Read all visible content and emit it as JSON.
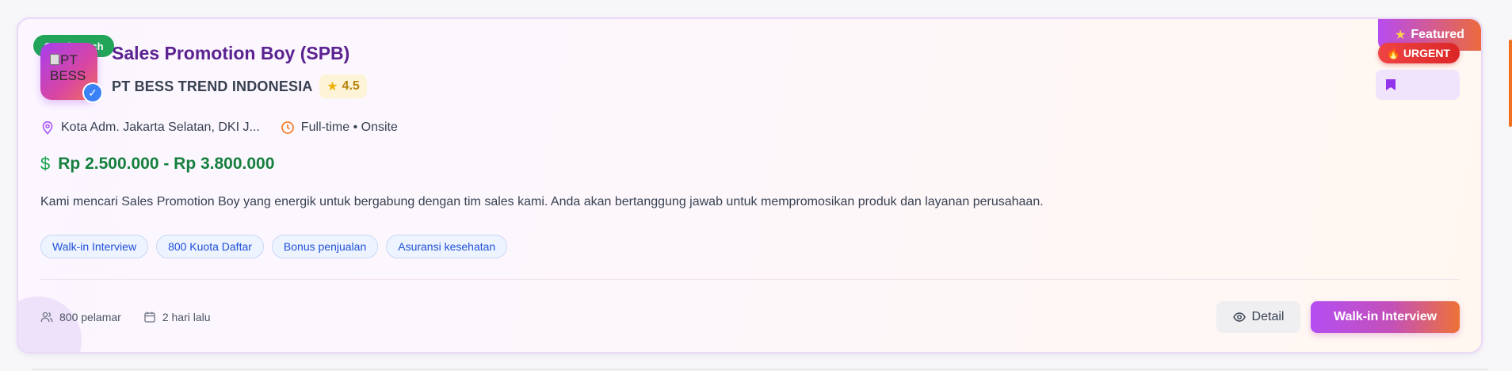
{
  "card": {
    "featured_label": "Featured",
    "urgent_label": "URGENT",
    "match_label": "Good Match",
    "logo_alt": "PT BESS",
    "verified_glyph": "✓",
    "title": "Sales Promotion Boy (SPB)",
    "company": "PT BESS TREND INDONESIA",
    "rating": "4.5",
    "location": "Kota Adm. Jakarta Selatan, DKI J...",
    "employment": "Full-time • Onsite",
    "salary": "Rp 2.500.000 - Rp 3.800.000",
    "description": "Kami mencari Sales Promotion Boy yang energik untuk bergabung dengan tim sales kami. Anda akan bertanggung jawab untuk mempromosikan produk dan layanan perusahaan.",
    "tags": [
      "Walk-in Interview",
      "800 Kuota Daftar",
      "Bonus penjualan",
      "Asuransi kesehatan"
    ],
    "applicants": "800 pelamar",
    "posted": "2 hari lalu",
    "detail_label": "Detail",
    "apply_label": "Walk-in Interview"
  },
  "icons": {
    "featured": "star-icon",
    "urgent": "fire-icon",
    "bookmark": "bookmark-icon",
    "rating": "star-icon",
    "location": "map-pin-icon",
    "employment": "clock-icon",
    "salary": "dollar-icon",
    "applicants": "users-icon",
    "posted": "calendar-icon",
    "detail": "eye-icon"
  },
  "colors": {
    "title": "#5b2291",
    "salary": "#15803d",
    "match": "#22a559",
    "urgent": "#dc2626",
    "accent_start": "#b44ef2",
    "accent_end": "#ee7236",
    "tag_text": "#1d4ed8"
  }
}
